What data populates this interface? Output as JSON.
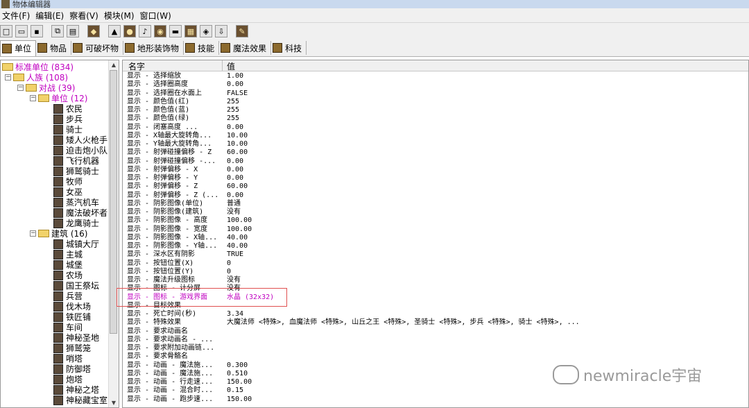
{
  "window": {
    "title": "物体编辑器"
  },
  "menu": [
    "文件(F)",
    "编辑(E)",
    "察看(V)",
    "模块(M)",
    "窗口(W)"
  ],
  "toolbar": {
    "buttons": [
      "new-file-icon",
      "open-folder-icon",
      "save-icon",
      "copy-icon",
      "paste-icon",
      "unit-icon",
      "terrain-icon",
      "gold-icon",
      "sound-icon",
      "model-icon",
      "tile-icon",
      "grid-icon",
      "object-icon",
      "import-icon",
      "edit-icon"
    ]
  },
  "tabs": [
    "单位",
    "物品",
    "可破坏物",
    "地形装饰物",
    "技能",
    "魔法效果",
    "科技"
  ],
  "tree": {
    "root": "标准单位 (834)",
    "race": "人族 (108)",
    "melee": "对战 (39)",
    "units_folder": "单位 (12)",
    "units": [
      "农民",
      "步兵",
      "骑士",
      "矮人火枪手",
      "迫击炮小队",
      "飞行机器",
      "狮鹫骑士",
      "牧师",
      "女巫",
      "蒸汽机车",
      "魔法破坏者",
      "龙鹰骑士"
    ],
    "buildings_folder": "建筑 (16)",
    "buildings": [
      "城镇大厅",
      "主城",
      "城堡",
      "农场",
      "国王祭坛",
      "兵营",
      "伐木场",
      "铁匠铺",
      "车间",
      "神秘圣地",
      "狮鹫笼",
      "哨塔",
      "防御塔",
      "炮塔",
      "神秘之塔",
      "神秘藏宝室"
    ]
  },
  "properties": {
    "header_name": "名字",
    "header_value": "值",
    "rows": [
      {
        "name": "显示 - 选择缩放",
        "value": "1.00"
      },
      {
        "name": "显示 - 选择圈高度",
        "value": "0.00"
      },
      {
        "name": "显示 - 选择圈在水面上",
        "value": "FALSE"
      },
      {
        "name": "显示 - 颜色值(红)",
        "value": "255"
      },
      {
        "name": "显示 - 颜色值(蓝)",
        "value": "255"
      },
      {
        "name": "显示 - 颜色值(绿)",
        "value": "255"
      },
      {
        "name": "显示 - 闭塞高度    ...",
        "value": "0.00"
      },
      {
        "name": "显示 - X轴最大旋转角...",
        "value": "10.00"
      },
      {
        "name": "显示 - Y轴最大旋转角...",
        "value": "10.00"
      },
      {
        "name": "显示 - 射弹碰撞偏移 - Z",
        "value": "60.00"
      },
      {
        "name": "显示 - 射弹碰撞偏移 -...",
        "value": "0.00"
      },
      {
        "name": "显示 - 射弹偏移 - X",
        "value": "0.00"
      },
      {
        "name": "显示 - 射弹偏移 - Y",
        "value": "0.00"
      },
      {
        "name": "显示 - 射弹偏移 - Z",
        "value": "60.00"
      },
      {
        "name": "显示 - 射弹偏移 - Z (...",
        "value": "0.00"
      },
      {
        "name": "显示 - 阴影图像(单位)",
        "value": "普通"
      },
      {
        "name": "显示 - 阴影图像(建筑)",
        "value": "没有"
      },
      {
        "name": "显示 - 阴影图像 - 高度",
        "value": "100.00"
      },
      {
        "name": "显示 - 阴影图像 - 宽度",
        "value": "100.00"
      },
      {
        "name": "显示 - 阴影图像 - X轴...",
        "value": "40.00"
      },
      {
        "name": "显示 - 阴影图像 - Y轴...",
        "value": "40.00"
      },
      {
        "name": "显示 - 深水区有阴影",
        "value": "TRUE"
      },
      {
        "name": "显示 - 按钮位置(X)",
        "value": "0"
      },
      {
        "name": "显示 - 按钮位置(Y)",
        "value": "0"
      },
      {
        "name": "显示 - 魔法升级图标",
        "value": "没有"
      },
      {
        "name": "显示 - 图标 - 计分屏",
        "value": "没有"
      },
      {
        "name": "显示 - 图标 - 游戏界面",
        "value": "水晶 (32x32)"
      },
      {
        "name": "显示 - 目标效果",
        "value": ""
      },
      {
        "name": "显示 - 死亡时间(秒)",
        "value": "3.34"
      },
      {
        "name": "显示 - 特殊效果",
        "value": "大魔法师 <特殊>, 血魔法师 <特殊>, 山丘之王 <特殊>, 圣骑士 <特殊>, 步兵 <特殊>, 骑士 <特殊>, ..."
      },
      {
        "name": "显示 - 要求动画名",
        "value": ""
      },
      {
        "name": "显示 - 要求动画名 - ...",
        "value": ""
      },
      {
        "name": "显示 - 要求附加动画链...",
        "value": ""
      },
      {
        "name": "显示 - 要求骨骼名",
        "value": ""
      },
      {
        "name": "显示 - 动画 - 魔法施...",
        "value": "0.300"
      },
      {
        "name": "显示 - 动画 - 魔法施...",
        "value": "0.510"
      },
      {
        "name": "显示 - 动画 - 行走速...",
        "value": "150.00"
      },
      {
        "name": "显示 - 动画 - 混合时...",
        "value": "0.15"
      },
      {
        "name": "显示 - 动画 - 跑步速...",
        "value": "150.00"
      }
    ]
  },
  "colors": {
    "highlight_text": "#c000c0",
    "highlight_box": "#e05050",
    "tree_text": "#c000c0"
  },
  "watermark": "newmiracle宇宙"
}
